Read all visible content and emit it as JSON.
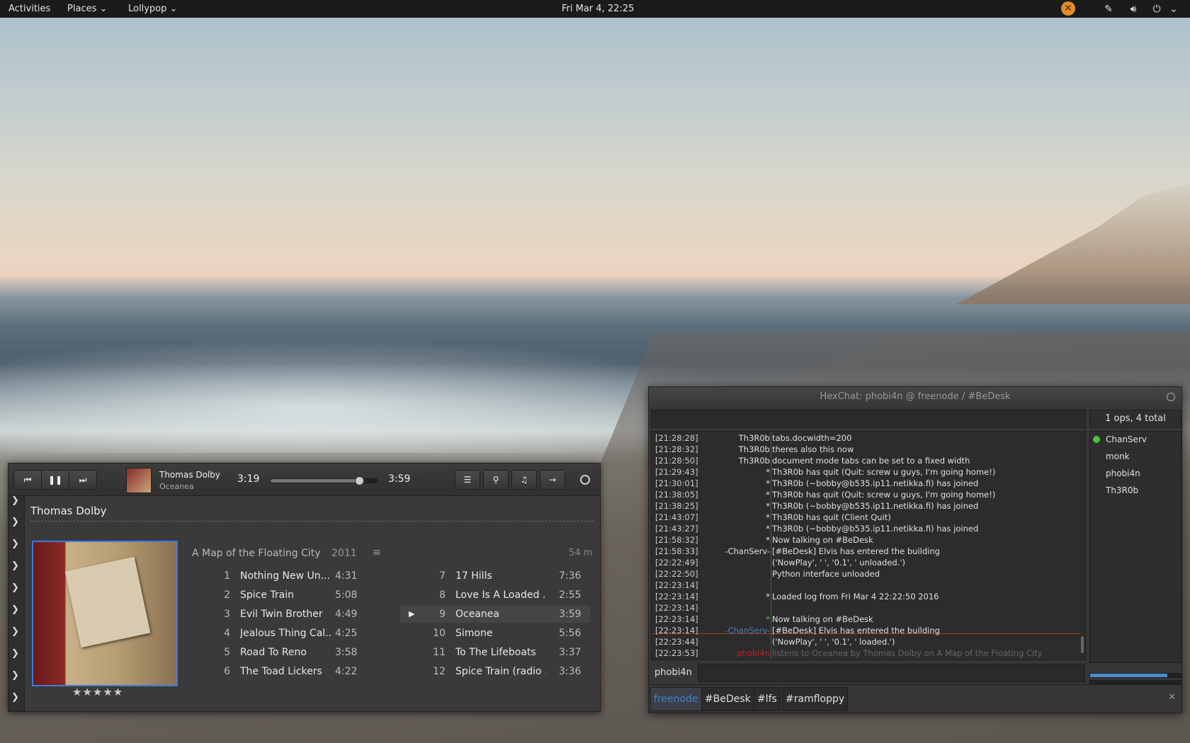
{
  "topbar": {
    "activities": "Activities",
    "places": "Places",
    "app_menu": "Lollypop",
    "clock": "Fri Mar  4, 22:25"
  },
  "player": {
    "now_artist": "Thomas Dolby",
    "now_track": "Oceanea",
    "elapsed": "3:19",
    "total": "3:59",
    "progress": 0.83,
    "artist_header": "Thomas Dolby",
    "album_title": "A Map of the Floating City",
    "album_year": "2011",
    "album_length": "54 m",
    "rating_stars": "★★★★★",
    "tracks_left": [
      {
        "n": "1",
        "title": "Nothing New Un...",
        "dur": "4:31"
      },
      {
        "n": "2",
        "title": "Spice Train",
        "dur": "5:08"
      },
      {
        "n": "3",
        "title": "Evil Twin Brother",
        "dur": "4:49"
      },
      {
        "n": "4",
        "title": "Jealous Thing Cal...",
        "dur": "4:25"
      },
      {
        "n": "5",
        "title": "Road To Reno",
        "dur": "3:58"
      },
      {
        "n": "6",
        "title": "The Toad Lickers",
        "dur": "4:22"
      }
    ],
    "tracks_right": [
      {
        "n": "7",
        "title": "17 Hills",
        "dur": "7:36"
      },
      {
        "n": "8",
        "title": "Love Is A Loaded ...",
        "dur": "2:55"
      },
      {
        "n": "9",
        "title": "Oceanea",
        "dur": "3:59"
      },
      {
        "n": "10",
        "title": "Simone",
        "dur": "5:56"
      },
      {
        "n": "11",
        "title": "To The Lifeboats",
        "dur": "3:37"
      },
      {
        "n": "12",
        "title": "Spice Train (radio ...",
        "dur": "3:36"
      }
    ],
    "playing_track_index": 2
  },
  "hexchat": {
    "title": "HexChat: phobi4n @ freenode / #BeDesk",
    "users_summary": "1 ops, 4 total",
    "users": [
      "ChanServ",
      "monk",
      "phobi4n",
      "Th3R0b"
    ],
    "nick_label": "phobi4n",
    "log": [
      {
        "ts": "[21:28:28]",
        "nick": "Th3R0b",
        "msg": "tabs.docwidth=200"
      },
      {
        "ts": "[21:28:32]",
        "nick": "Th3R0b",
        "msg": "theres also this now"
      },
      {
        "ts": "[21:28:50]",
        "nick": "Th3R0b",
        "msg": "document mode tabs can be set to a fixed width"
      },
      {
        "ts": "[21:29:43]",
        "nick": "*",
        "msg": "Th3R0b has quit (Quit: screw u guys, I'm going home!)"
      },
      {
        "ts": "[21:30:01]",
        "nick": "*",
        "msg": "Th3R0b (~bobby@b535.ip11.netikka.fi) has joined"
      },
      {
        "ts": "[21:38:05]",
        "nick": "*",
        "msg": "Th3R0b has quit (Quit: screw u guys, I'm going home!)"
      },
      {
        "ts": "[21:38:25]",
        "nick": "*",
        "msg": "Th3R0b (~bobby@b535.ip11.netikka.fi) has joined"
      },
      {
        "ts": "[21:43:07]",
        "nick": "*",
        "msg": "Th3R0b has quit (Client Quit)"
      },
      {
        "ts": "[21:43:27]",
        "nick": "*",
        "msg": "Th3R0b (~bobby@b535.ip11.netikka.fi) has joined"
      },
      {
        "ts": "[21:58:32]",
        "nick": "*",
        "msg": "Now talking on #BeDesk"
      },
      {
        "ts": "[21:58:33]",
        "nick": "-ChanServ-",
        "msg": "[#BeDesk] Elvis has entered the building"
      },
      {
        "ts": "[22:22:49]",
        "nick": "",
        "msg": "('NowPlay', ' ', '0.1', ' unloaded.')"
      },
      {
        "ts": "[22:22:50]",
        "nick": "",
        "msg": "Python interface unloaded"
      },
      {
        "ts": "[22:23:14]",
        "nick": "",
        "msg": ""
      },
      {
        "ts": "[22:23:14]",
        "nick": "*",
        "msg": "Loaded log from Fri Mar  4 22:22:50 2016"
      },
      {
        "ts": "[22:23:14]",
        "nick": "",
        "msg": ""
      },
      {
        "ts": "[22:23:14]",
        "nick": "*",
        "msg": "Now talking on #BeDesk"
      },
      {
        "ts": "[22:23:14]",
        "nick": "-ChanServ-",
        "msg": "[#BeDesk] Elvis has entered the building"
      },
      {
        "ts": "[22:23:44]",
        "nick": "",
        "msg": "('NowPlay', ' ', '0.1', ' loaded.')"
      },
      {
        "ts": "[22:23:53]",
        "nick": "phobi4n",
        "msg": "listens to Oceanea by Thomas Dolby on A Map of the Floating City"
      }
    ],
    "tabs": [
      "freenode",
      "#BeDesk",
      "#lfs",
      "#ramfloppy"
    ],
    "colors": {
      "chanserv": "#4a7fc0",
      "phobi4n": "#c02020",
      "channel_link": "#7a4a9a",
      "online": "#4cc33c",
      "tab_active": "#4a7fc0"
    }
  }
}
